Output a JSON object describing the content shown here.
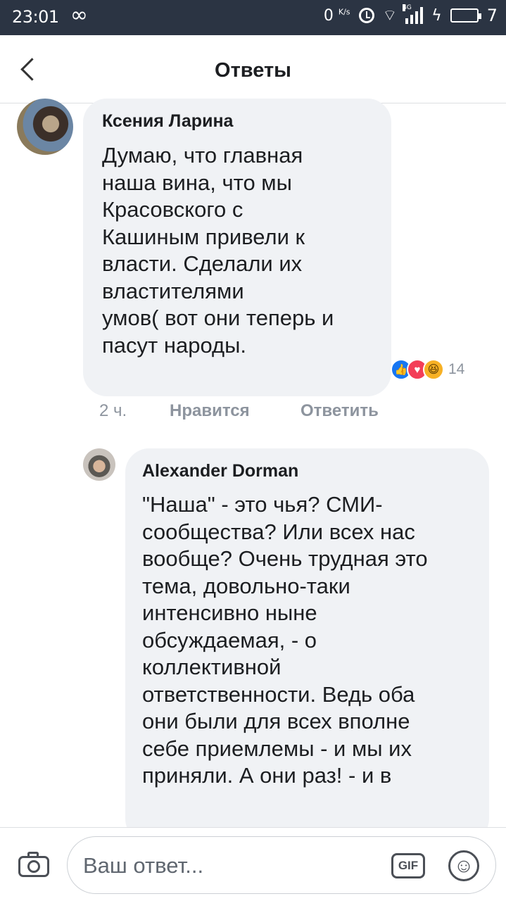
{
  "status_bar": {
    "time": "23:01",
    "infinity": "∞",
    "net_speed": "0",
    "net_unit": "K/s",
    "network_type": "4G",
    "battery_level": "7"
  },
  "header": {
    "title": "Ответы"
  },
  "comments": [
    {
      "author": "Ксения Ларина",
      "text": "Думаю, что главная\nнаша вина, что мы\nКрасовского с\nКашиным привели к\nвласти.  Сделали их\nвластителями\nумов( вот они теперь и\nпасут народы.",
      "reactions": [
        "like",
        "love",
        "haha"
      ],
      "reaction_count": "14",
      "time": "2 ч.",
      "like_label": "Нравится",
      "reply_label": "Ответить"
    },
    {
      "author": "Alexander Dorman",
      "text": "\"Наша\" - это чья? СМИ-\nсообщества? Или всех нас\nвообще? Очень трудная это\nтема, довольно-таки\nинтенсивно ныне\nобсуждаемая, - о\nколлективной\nответственности. Ведь оба\nони были для всех вполне\nсебе приемлемы - и мы их\nприняли. А они раз! - и в"
    }
  ],
  "reply_bar": {
    "placeholder": "Ваш ответ...",
    "gif_label": "GIF"
  },
  "colors": {
    "status_bar": "#2b3443",
    "bubble": "#f0f2f5",
    "muted_text": "#8d949e",
    "like": "#1877f2",
    "love": "#f33e58",
    "haha": "#f7b125"
  }
}
